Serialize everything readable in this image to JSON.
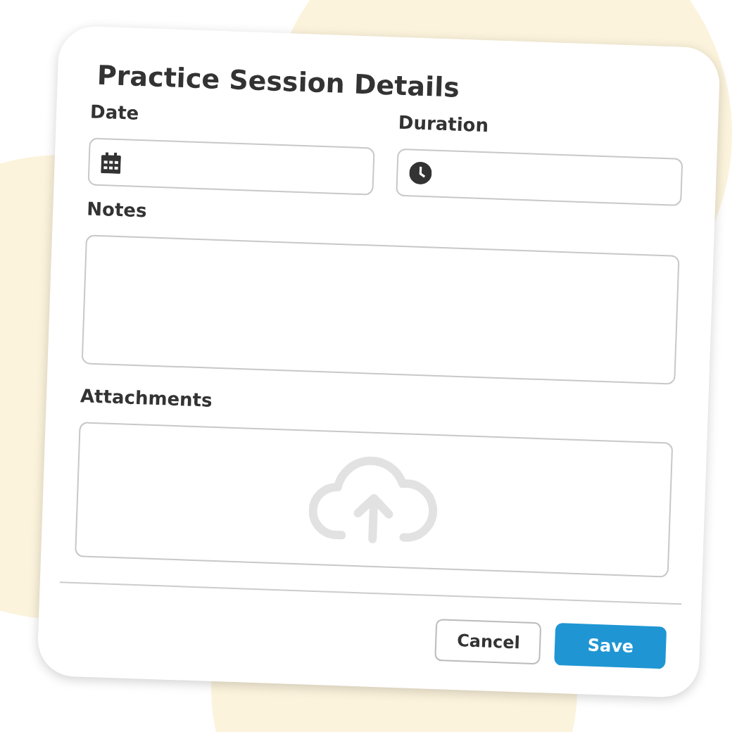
{
  "dialog": {
    "title": "Practice Session Details"
  },
  "fields": [
    {
      "label": "Date",
      "kind": "date"
    },
    {
      "label": "Duration",
      "kind": "time"
    }
  ],
  "notes": {
    "label": "Notes"
  },
  "attachments": {
    "label": "Attachments"
  },
  "buttons": [
    {
      "label": "Cancel",
      "kind": "secondary"
    },
    {
      "label": "Save",
      "kind": "primary"
    }
  ]
}
